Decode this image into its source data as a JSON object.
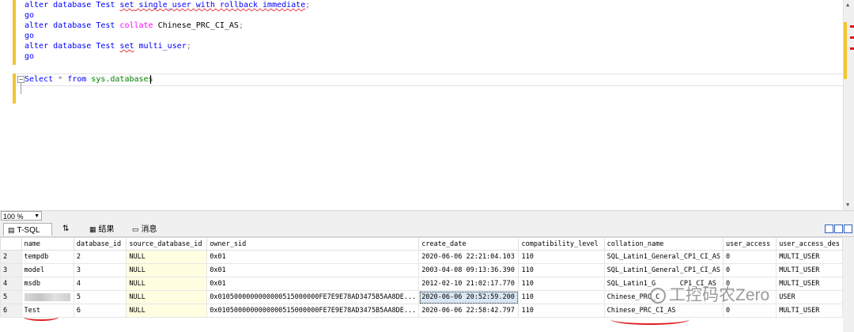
{
  "editor": {
    "lines": [
      {
        "kw1": "alter",
        "db": " database Test ",
        "set": "set",
        "rest": " single_user with rollback immediate",
        "end": ";"
      },
      {
        "go": "go"
      },
      {
        "kw1": "alter",
        "db": " database Test ",
        "fn": "collate",
        "rest": " Chinese_PRC_CI_AS",
        "end": ";"
      },
      {
        "go": "go"
      },
      {
        "kw1": "alter",
        "db": " database Test ",
        "set": "set",
        "rest": " multi_user",
        "end": ";"
      },
      {
        "go": "go"
      }
    ],
    "select": {
      "kw": "Select",
      "star": " * ",
      "from": "from",
      "obj": " sys.databases"
    }
  },
  "status": {
    "zoom": "100 %"
  },
  "tabs": [
    {
      "label": "T-SQL",
      "icon": "document-icon"
    },
    {
      "label": "⇅",
      "icon": "sort-icon"
    },
    {
      "label": "结果",
      "icon": "grid-icon"
    },
    {
      "label": "消息",
      "icon": "message-icon"
    }
  ],
  "results": {
    "columns": [
      "name",
      "database_id",
      "source_database_id",
      "owner_sid",
      "create_date",
      "compatibility_level",
      "collation_name",
      "user_access",
      "user_access_des"
    ],
    "rows": [
      [
        "2",
        "tempdb",
        "2",
        "NULL",
        "0x01",
        "2020-06-06 22:21:04.103",
        "110",
        "SQL_Latin1_General_CP1_CI_AS",
        "0",
        "MULTI_USER"
      ],
      [
        "3",
        "model",
        "3",
        "NULL",
        "0x01",
        "2003-04-08 09:13:36.390",
        "110",
        "SQL_Latin1_General_CP1_CI_AS",
        "0",
        "MULTI_USER"
      ],
      [
        "4",
        "msdb",
        "4",
        "NULL",
        "0x01",
        "2012-02-10 21:02:17.770",
        "110",
        "SQL_Latin1_G      CP1_CI_AS",
        "0",
        "MULTI_USER"
      ],
      [
        "5",
        "",
        "5",
        "NULL",
        "0x0105000000000000515000000FE7E9E78AD3475B5AA8DE...",
        "2020-06-06 20:52:59.200",
        "110",
        "Chinese_PRC_C",
        "",
        "USER"
      ],
      [
        "6",
        "Test",
        "6",
        "NULL",
        "0x0105000000000000515000000FE7E9E78AD3475B5AA8DE...",
        "2020-06-06 22:58:42.797",
        "110",
        "Chinese_PRC_CI_AS",
        "0",
        "MULTI_USER"
      ]
    ]
  },
  "watermark": {
    "text": "工控码农Zero"
  },
  "colors": {
    "keyword": "#0000ff",
    "function": "#ff00ff",
    "change_bar": "#f2c531",
    "null_cell": "#fffee1",
    "annotation": "#e02020"
  }
}
